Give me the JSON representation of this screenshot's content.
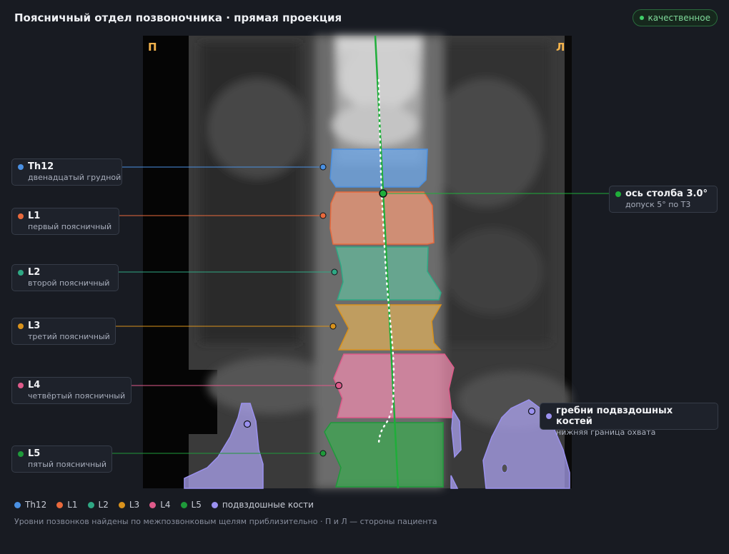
{
  "header": {
    "title": "Поясничный отдел позвоночника · прямая проекция",
    "status_label": "качественное"
  },
  "image": {
    "side_left": "П",
    "side_right": "Л"
  },
  "vertebrae": [
    {
      "id": "Th12",
      "label": "Th12",
      "description": "двенадцатый грудной",
      "color": "#4a90e2"
    },
    {
      "id": "L1",
      "label": "L1",
      "description": "первый поясничный",
      "color": "#e8693c"
    },
    {
      "id": "L2",
      "label": "L2",
      "description": "второй поясничный",
      "color": "#2fa884"
    },
    {
      "id": "L3",
      "label": "L3",
      "description": "третий поясничный",
      "color": "#d9921c"
    },
    {
      "id": "L4",
      "label": "L4",
      "description": "четвёртый поясничный",
      "color": "#df5a8a"
    },
    {
      "id": "L5",
      "label": "L5",
      "description": "пятый поясничный",
      "color": "#1f9a3a"
    }
  ],
  "axis": {
    "label": "ось столба 3.0°",
    "tolerance": "допуск 5° по Т3",
    "color": "#1fae3a"
  },
  "iliac": {
    "label": "гребни подвздошных костей",
    "description": "нижняя граница охвата",
    "color": "#9b91f0"
  },
  "legend": [
    {
      "label": "Th12",
      "color": "#4a90e2"
    },
    {
      "label": "L1",
      "color": "#e8693c"
    },
    {
      "label": "L2",
      "color": "#2fa884"
    },
    {
      "label": "L3",
      "color": "#d9921c"
    },
    {
      "label": "L4",
      "color": "#df5a8a"
    },
    {
      "label": "L5",
      "color": "#1f9a3a"
    },
    {
      "label": "подвздошные кости",
      "color": "#9b91f0"
    }
  ],
  "footer_note": "Уровни позвонков найдены по межпозвонковым щелям приблизительно · П и Л — стороны пациента"
}
